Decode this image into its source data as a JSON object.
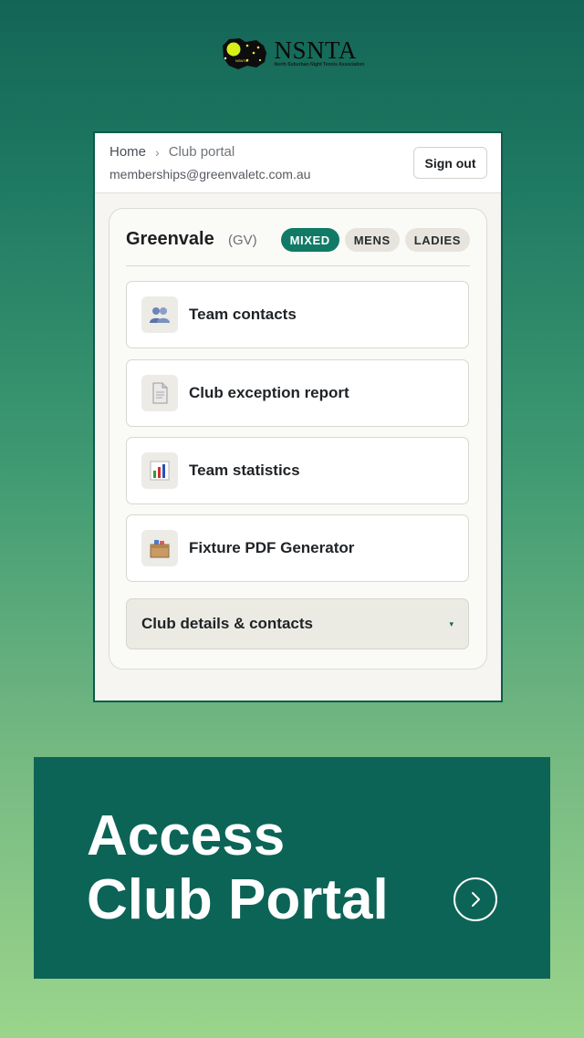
{
  "logo": {
    "name": "NSNTA",
    "tagline": "North Suburban Night Tennis Association",
    "badge_text": "NSNTA"
  },
  "breadcrumb": {
    "home": "Home",
    "separator": "›",
    "current": "Club portal"
  },
  "account": {
    "email": "memberships@greenvaletc.com.au",
    "sign_out_label": "Sign out"
  },
  "club": {
    "name": "Greenvale",
    "code": "(GV)",
    "filters": [
      {
        "label": "MIXED",
        "active": true
      },
      {
        "label": "MENS",
        "active": false
      },
      {
        "label": "LADIES",
        "active": false
      }
    ]
  },
  "menu": [
    {
      "label": "Team contacts",
      "icon": "team-contacts-icon"
    },
    {
      "label": "Club exception report",
      "icon": "document-icon"
    },
    {
      "label": "Team statistics",
      "icon": "bar-chart-icon"
    },
    {
      "label": "Fixture PDF Generator",
      "icon": "box-icon"
    }
  ],
  "details": {
    "label": "Club details & contacts",
    "caret": "▾"
  },
  "cta": {
    "line1": "Access",
    "line2": "Club Portal",
    "icon": "chevron-right-icon"
  },
  "colors": {
    "accent": "#117a66",
    "cta_bg": "#0c6457"
  }
}
